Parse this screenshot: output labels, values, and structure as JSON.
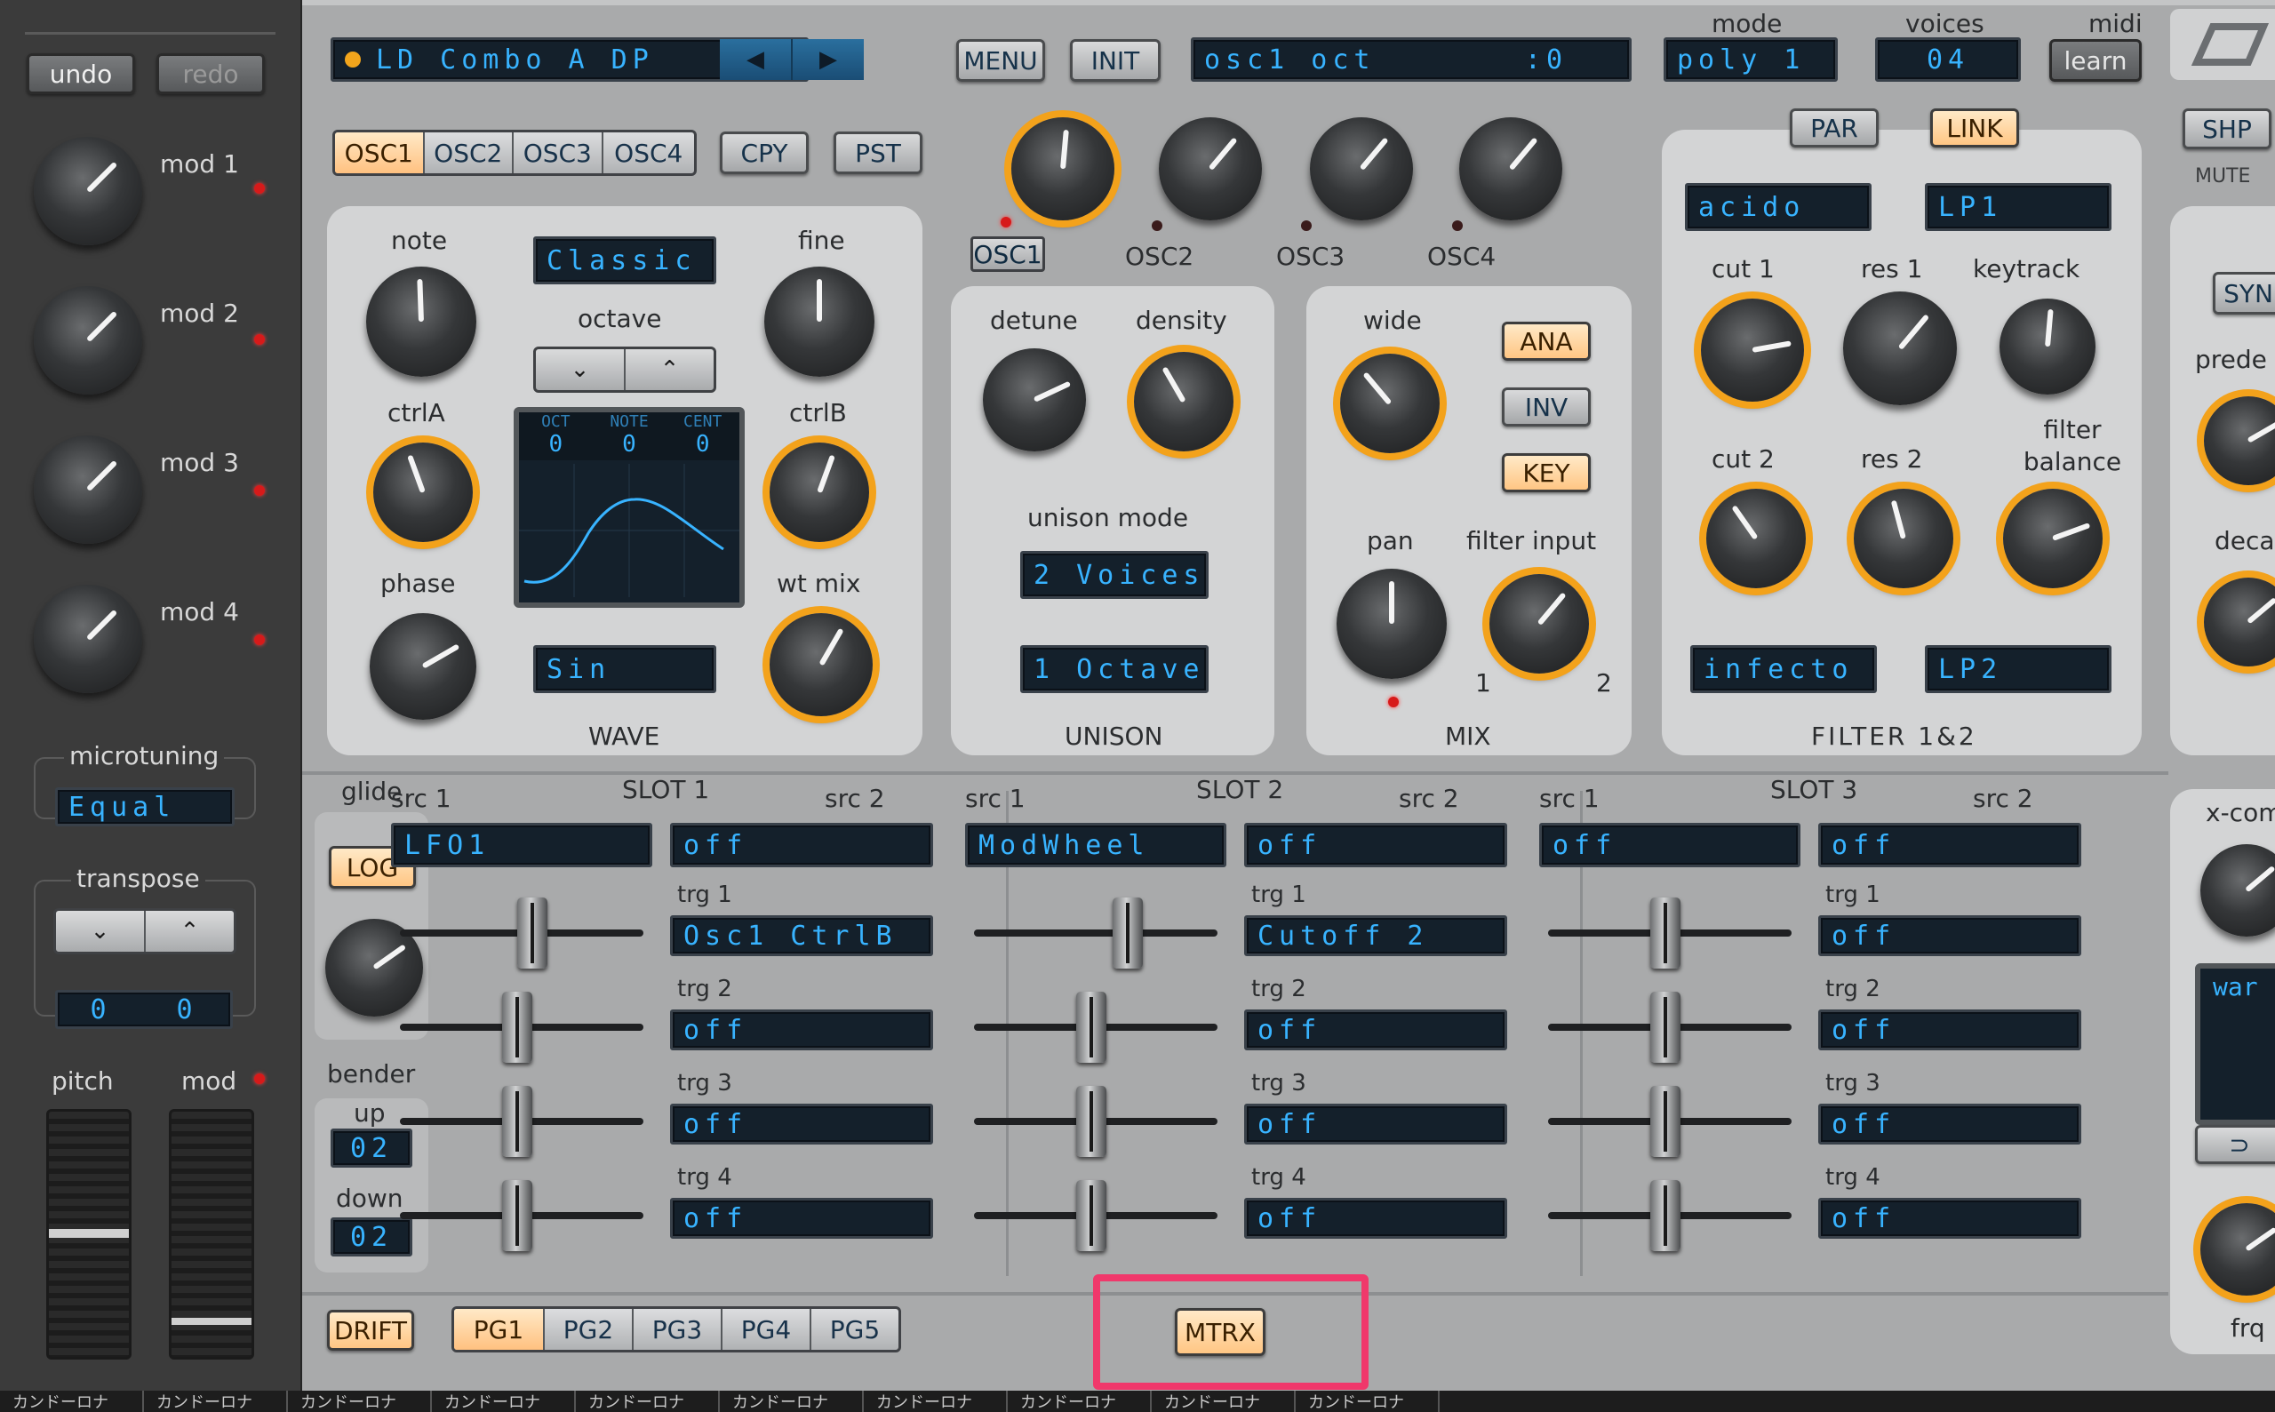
{
  "left": {
    "undo": "undo",
    "redo": "redo",
    "mods": [
      "mod 1",
      "mod 2",
      "mod 3",
      "mod 4"
    ],
    "microtuning_label": "microtuning",
    "microtuning_value": "Equal",
    "transpose_label": "transpose",
    "transpose_values": [
      "0",
      "0"
    ],
    "pitch_label": "pitch",
    "mod_label": "mod"
  },
  "header": {
    "preset_name": "LD Combo A DP",
    "menu": "MENU",
    "init": "INIT",
    "param_display": "osc1 oct       :0",
    "mode_label": "mode",
    "mode_value": "poly 1",
    "voices_label": "voices",
    "voices_value": "04",
    "midi_label": "midi",
    "midi_value": "learn"
  },
  "osc": {
    "tabs": [
      "OSC1",
      "OSC2",
      "OSC3",
      "OSC4"
    ],
    "active_tab": "OSC1",
    "cpy": "CPY",
    "pst": "PST",
    "mix_knob_labels": [
      "OSC1",
      "OSC2",
      "OSC3",
      "OSC4"
    ],
    "note": "note",
    "fine": "fine",
    "ctrlA": "ctrlA",
    "ctrlB": "ctrlB",
    "phase": "phase",
    "wt_mix": "wt mix",
    "wave_type": "Classic",
    "octave": "octave",
    "display_headers": [
      "OCT",
      "NOTE",
      "CENT"
    ],
    "display_values": [
      "0",
      "0",
      "0"
    ],
    "wave_shape": "Sin",
    "section": "WAVE"
  },
  "unison": {
    "detune": "detune",
    "density": "density",
    "mode_label": "unison mode",
    "voices_value": "2 Voices",
    "octave_value": "1 Octave",
    "section": "UNISON"
  },
  "mix": {
    "wide": "wide",
    "ana": "ANA",
    "inv": "INV",
    "key": "KEY",
    "pan": "pan",
    "filter_input": "filter input",
    "fi_min": "1",
    "fi_max": "2",
    "section": "MIX"
  },
  "filter": {
    "par": "PAR",
    "link": "LINK",
    "type1": "acido",
    "mode1": "LP1",
    "cut1": "cut 1",
    "res1": "res 1",
    "keytrack": "keytrack",
    "cut2": "cut 2",
    "res2": "res 2",
    "balance": "filter balance",
    "type2": "infecto",
    "mode2": "LP2",
    "section": "FILTER 1&2"
  },
  "right": {
    "shp": "SHP",
    "mute": "MUTE",
    "syn": "SYN",
    "prede": "prede",
    "deca": "deca",
    "xcom": "x-com",
    "war": "war",
    "frq": "frq"
  },
  "matrix": {
    "glide": "glide",
    "log": "LOG",
    "bender": "bender",
    "up": "up",
    "up_value": "02",
    "down": "down",
    "down_value": "02",
    "slots": [
      {
        "title": "SLOT 1",
        "src1_label": "src 1",
        "src2_label": "src 2",
        "src1": "LFO1",
        "src2": "off",
        "trg_labels": [
          "trg 1",
          "trg 2",
          "trg 3",
          "trg 4"
        ],
        "trgs": [
          "Osc1 CtrlB",
          "off",
          "off",
          "off"
        ],
        "amounts": [
          0.55,
          0.48,
          0.48,
          0.48
        ]
      },
      {
        "title": "SLOT 2",
        "src1_label": "src 1",
        "src2_label": "src 2",
        "src1": "ModWheel",
        "src2": "off",
        "trg_labels": [
          "trg 1",
          "trg 2",
          "trg 3",
          "trg 4"
        ],
        "trgs": [
          "Cutoff 2",
          "off",
          "off",
          "off"
        ],
        "amounts": [
          0.65,
          0.48,
          0.48,
          0.48
        ]
      },
      {
        "title": "SLOT 3",
        "src1_label": "src 1",
        "src2_label": "src 2",
        "src1": "off",
        "src2": "off",
        "trg_labels": [
          "trg 1",
          "trg 2",
          "trg 3",
          "trg 4"
        ],
        "trgs": [
          "off",
          "off",
          "off",
          "off"
        ],
        "amounts": [
          0.48,
          0.48,
          0.48,
          0.48
        ]
      }
    ]
  },
  "bottom": {
    "drift": "DRIFT",
    "pages": [
      "PG1",
      "PG2",
      "PG3",
      "PG4",
      "PG5"
    ],
    "active_page": "PG1",
    "mtrx": "MTRX"
  },
  "taskbar": [
    "カンドーロナ",
    "カンドーロナ",
    "カンドーロナ",
    "カンドーロナ",
    "カンドーロナ",
    "カンドーロナ",
    "カンドーロナ",
    "カンドーロナ",
    "カンドーロナ",
    "カンドーロナ"
  ],
  "colors": {
    "accent": "#f3a21b",
    "lcd_text": "#38b3ff",
    "highlight": "#f0386b"
  }
}
